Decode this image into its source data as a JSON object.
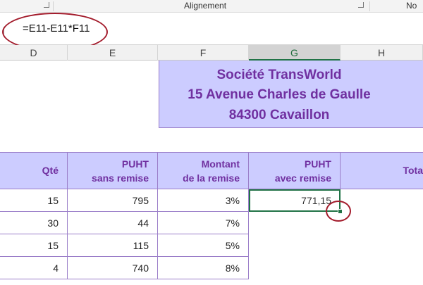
{
  "ribbon": {
    "alignment_label": "Alignement",
    "right_label": "No"
  },
  "formula_bar": {
    "formula": "=E11-E11*F11"
  },
  "columns": [
    {
      "letter": "D",
      "selected": false
    },
    {
      "letter": "E",
      "selected": false
    },
    {
      "letter": "F",
      "selected": false
    },
    {
      "letter": "G",
      "selected": true
    },
    {
      "letter": "H",
      "selected": false
    }
  ],
  "company": {
    "name": "Société TransWorld",
    "address": "15 Avenue Charles de Gaulle",
    "city": "84300 Cavaillon"
  },
  "table": {
    "headers": {
      "qty": "Qté",
      "puht_sans_1": "PUHT",
      "puht_sans_2": "sans remise",
      "montant_1": "Montant",
      "montant_2": "de la remise",
      "puht_avec_1": "PUHT",
      "puht_avec_2": "avec remise",
      "total": "Tota"
    },
    "rows": [
      {
        "qty": "15",
        "puht": "795",
        "remise": "3%",
        "puht_avec": "771,15"
      },
      {
        "qty": "30",
        "puht": "44",
        "remise": "7%",
        "puht_avec": ""
      },
      {
        "qty": "15",
        "puht": "115",
        "remise": "5%",
        "puht_avec": ""
      },
      {
        "qty": "4",
        "puht": "740",
        "remise": "8%",
        "puht_avec": ""
      }
    ]
  },
  "colors": {
    "accent_purple": "#7030a0",
    "header_fill": "#ccccff",
    "annotation_red": "#a31c2c",
    "selection_green": "#217346"
  }
}
